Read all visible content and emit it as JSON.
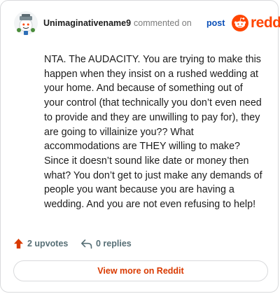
{
  "comment": {
    "username": "Unimaginativename9",
    "action_text": "commented on",
    "post_link": "post",
    "brand": "reddit",
    "avatar_icon": "snoo-avatar-icon",
    "body": "NTA. The AUDACITY. You are trying to make this happen when they insist on a rushed wedding at your home. And because of something out of your control (that technically you don’t even need to provide and they are unwilling to pay for), they are going to villainize you?? What accommodations are THEY willing to make? Since it doesn’t sound like date or money then what? You don’t get to just make any demands of people you want because you are having a wedding. And you are not even refusing to help!",
    "upvotes": "2 upvotes",
    "replies": "0 replies",
    "view_more": "View more on Reddit"
  },
  "colors": {
    "brand_orange": "#ff4500",
    "link_blue": "#0a4fb8",
    "muted_gray": "#7c7c7c",
    "meta_gray": "#576f76",
    "button_text": "#d93a00",
    "border": "#d9dadc"
  },
  "icons": {
    "upvote": "upvote-arrow-icon",
    "reply": "reply-arrow-icon",
    "logo": "reddit-logo-icon"
  }
}
